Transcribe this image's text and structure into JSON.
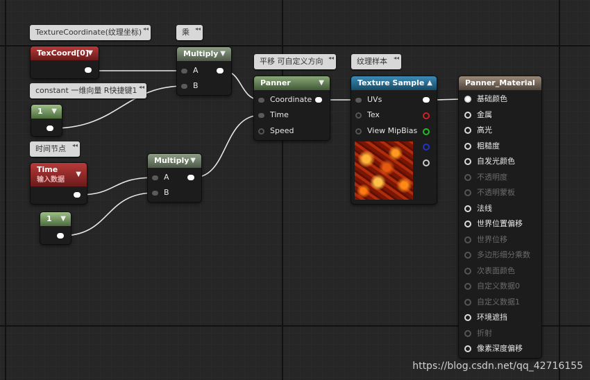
{
  "comments": {
    "texcoord": "TextureCoordinate(纹理坐标)",
    "multiply_top": "乘",
    "constant": "constant 一维向量 R快捷键1",
    "time_node": "时间节点",
    "panner": "平移 可自定义方向",
    "texture": "纹理样本"
  },
  "nodes": {
    "texcoord": {
      "title": "TexCoord[0]"
    },
    "constant_top": {
      "title": "1"
    },
    "time": {
      "title": "Time",
      "subtitle": "输入数据"
    },
    "constant_bottom": {
      "title": "1"
    },
    "multiply_top": {
      "title": "Multiply",
      "inputs": [
        "A",
        "B"
      ]
    },
    "multiply_bottom": {
      "title": "Multiply",
      "inputs": [
        "A",
        "B"
      ]
    },
    "panner": {
      "title": "Panner",
      "inputs": [
        "Coordinate",
        "Time",
        "Speed"
      ]
    },
    "texture_sample": {
      "title": "Texture Sample",
      "inputs": [
        "UVs",
        "Tex",
        "View MipBias"
      ]
    },
    "material": {
      "title": "Panner_Material",
      "inputs": [
        "基础颜色",
        "金属",
        "高光",
        "粗糙度",
        "自发光颜色",
        "不透明度",
        "不透明蒙板",
        "法线",
        "世界位置偏移",
        "世界位移",
        "多边形细分乘数",
        "次表面颜色",
        "自定义数据0",
        "自定义数据1",
        "环境遮挡",
        "折射",
        "像素深度偏移"
      ]
    }
  },
  "pin_colors": {
    "r": "#cc2222",
    "g": "#22bb22",
    "b": "#2233cc",
    "a": "#cccccc"
  },
  "watermark": "https://blog.csdn.net/qq_42716155"
}
